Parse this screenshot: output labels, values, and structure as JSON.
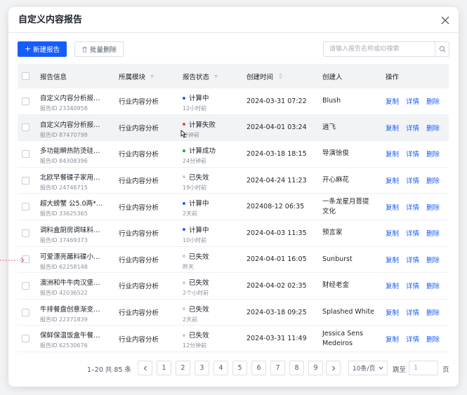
{
  "dialog": {
    "title": "自定义内容报告"
  },
  "toolbar": {
    "new_label": "新建报告",
    "batch_delete_label": "批量删除"
  },
  "search": {
    "placeholder": "请输入报告名称或ID搜索"
  },
  "columns": {
    "info": "报告信息",
    "module": "所属模块",
    "status": "报告状态",
    "created": "创建时间",
    "creator": "创建人",
    "ops": "操作"
  },
  "ops": {
    "copy": "复制",
    "detail": "详情",
    "delete": "删除"
  },
  "rows": [
    {
      "name": "自定义内容分析报…",
      "id": "报告ID 23340958",
      "module": "行业内容分析",
      "status": "计算中",
      "status_color": "#165dff",
      "ago": "12小时前",
      "time": "2024-03-31 07:22",
      "creator": "Blush",
      "creator2": ""
    },
    {
      "name": "自定义内容分析报…",
      "id": "报告ID 87470798",
      "module": "行业内容分析",
      "status": "计算失败",
      "status_color": "#f53f3f",
      "ago": "分钟前",
      "time": "2024-04-01 03:24",
      "creator": "逍飞",
      "creator2": ""
    },
    {
      "name": "多功能瞬热防烫硅…",
      "id": "报告ID 84308396",
      "module": "行业内容分析",
      "status": "计算成功",
      "status_color": "#00b42a",
      "ago": "24分钟前",
      "time": "2024-03-18 18:15",
      "creator": "导演徐俊",
      "creator2": ""
    },
    {
      "name": "北欧早餐碟子家用…",
      "id": "报告ID 24746715",
      "module": "行业内容分析",
      "status": "已失效",
      "status_color": "#c9cdd4",
      "ago": "19小时前",
      "time": "2024-04-24 11:23",
      "creator": "开心麻花",
      "creator2": ""
    },
    {
      "name": "超大螃蟹 公5.0两*…",
      "id": "报告ID 33625365",
      "module": "行业内容分析",
      "status": "计算中",
      "status_color": "#165dff",
      "ago": "2天前",
      "time": "202408-12 06:35",
      "creator": "一条龙星月菩提",
      "creator2": "文化"
    },
    {
      "name": "调料盒厨房调味料…",
      "id": "报告ID 37469373",
      "module": "行业内容分析",
      "status": "计算中",
      "status_color": "#165dff",
      "ago": "10小时前",
      "time": "2024-04-03 11:35",
      "creator": "预言家",
      "creator2": ""
    },
    {
      "name": "可爱漂亮蘸料碟小…",
      "id": "报告ID 62258148",
      "module": "行业内容分析",
      "status": "已失效",
      "status_color": "#c9cdd4",
      "ago": "昨天",
      "time": "2024-04-01 16:05",
      "creator": "Sunburst",
      "creator2": ""
    },
    {
      "name": "澳洲和牛牛肉汉堡…",
      "id": "报告ID 42036522",
      "module": "行业内容分析",
      "status": "已失效",
      "status_color": "#c9cdd4",
      "ago": "2个小时前",
      "time": "2024-04-02 02:35",
      "creator": "财经老金",
      "creator2": ""
    },
    {
      "name": "牛排餐盘创意渐变…",
      "id": "报告ID 22371839",
      "module": "行业内容分析",
      "status": "已失效",
      "status_color": "#c9cdd4",
      "ago": "2天前",
      "time": "2024-03-18 09:25",
      "creator": "Splashed White",
      "creator2": ""
    },
    {
      "name": "保鲜保温饭盒午餐…",
      "id": "报告ID 62530676",
      "module": "行业内容分析",
      "status": "已失效",
      "status_color": "#c9cdd4",
      "ago": "12分钟前",
      "time": "2024-03-31 11:49",
      "creator": "Jessica Sens",
      "creator2": "Medeiros"
    }
  ],
  "pagination": {
    "summary": "1–20 共 85 条",
    "pages": [
      "1",
      "2",
      "3",
      "4",
      "5",
      "6",
      "7",
      "8",
      "9"
    ],
    "page_size": "10条/页",
    "goto_label": "跳至",
    "goto_value": "1",
    "page_unit": "页"
  }
}
